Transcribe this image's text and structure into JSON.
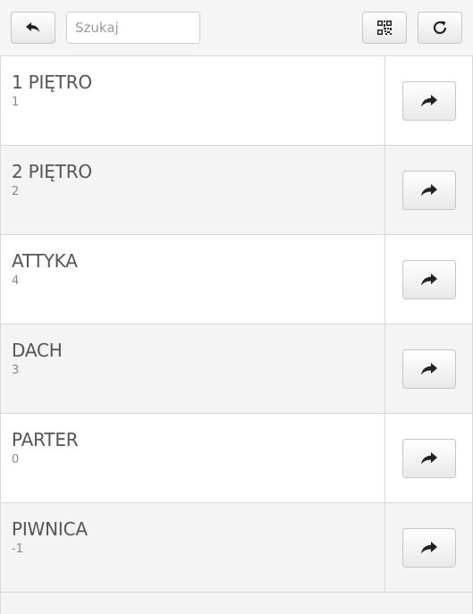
{
  "toolbar": {
    "back_icon": "reply-arrow-icon",
    "search_placeholder": "Szukaj",
    "search_value": "",
    "qr_icon": "qr-code-icon",
    "refresh_icon": "refresh-icon"
  },
  "levels": [
    {
      "name": "1 PIĘTRO",
      "code": "1"
    },
    {
      "name": "2 PIĘTRO",
      "code": "2"
    },
    {
      "name": "ATTYKA",
      "code": "4"
    },
    {
      "name": "DACH",
      "code": "3"
    },
    {
      "name": "PARTER",
      "code": "0"
    },
    {
      "name": "PIWNICA",
      "code": "-1"
    }
  ],
  "row_action_icon": "forward-arrow-icon",
  "colors": {
    "row_alt_bg": "#f4f4f4",
    "border": "#d9d9d9",
    "title_text": "#555555",
    "subtitle_text": "#8a8a8a"
  }
}
